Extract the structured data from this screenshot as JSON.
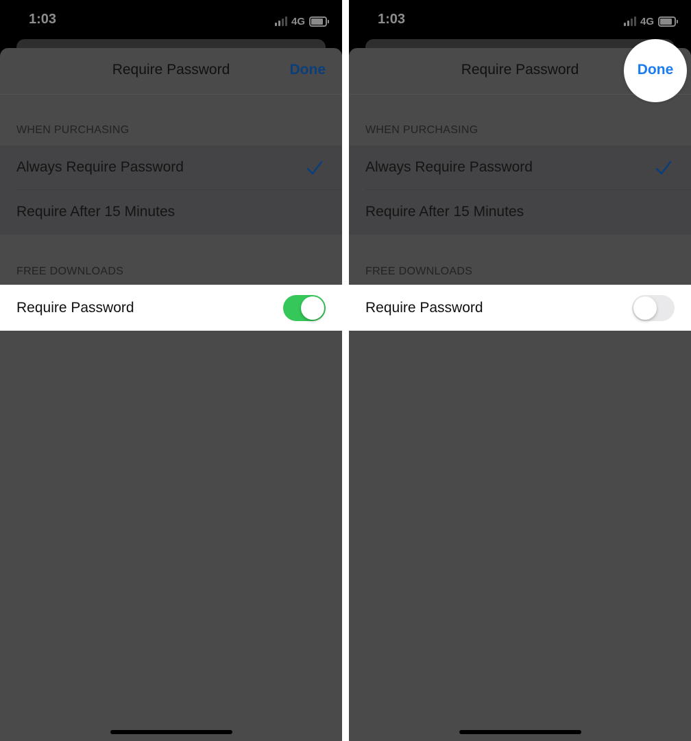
{
  "status": {
    "time": "1:03",
    "network": "4G"
  },
  "nav": {
    "title": "Require Password",
    "done_label": "Done"
  },
  "purchasing": {
    "header": "WHEN PURCHASING",
    "options": [
      {
        "label": "Always Require Password",
        "selected": true
      },
      {
        "label": "Require After 15 Minutes",
        "selected": false
      }
    ]
  },
  "free_downloads": {
    "header": "FREE DOWNLOADS",
    "toggle_label": "Require Password"
  },
  "left_screen": {
    "require_password_on": true
  },
  "right_screen": {
    "require_password_on": false
  },
  "colors": {
    "accent_blue": "#1a7cf0",
    "toggle_on": "#35c759",
    "toggle_off": "#e9e9eb"
  },
  "icons": [
    "signal-icon",
    "battery-icon",
    "checkmark-icon"
  ]
}
